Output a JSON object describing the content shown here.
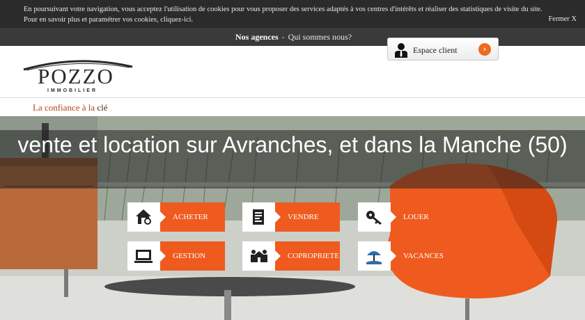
{
  "cookie_bar": {
    "line1": "En poursuivant votre navigation, vous acceptez l'utilisation de cookies pour vous proposer des services adaptés à vos centres d'intérêts et réaliser des statistiques de visite du site.",
    "line2": "Pour en savoir plus et paramétrer vos cookies, cliquez-ici.",
    "close": "Fermer X"
  },
  "nav": {
    "agences": "Nos agences",
    "separator": "-",
    "about": "Qui sommes nous?"
  },
  "client_button": {
    "label": "Espace client",
    "icon": "person-icon",
    "arrow": "›"
  },
  "logo": {
    "word": "POZZO",
    "sub": "IMMOBILIER"
  },
  "tagline": {
    "text": "La confiance à la ",
    "highlight": "clé"
  },
  "hero": {
    "title": "vente et location sur Avranches, et dans la Manche (50)"
  },
  "services": [
    {
      "label": "ACHETER",
      "icon": "house-icon"
    },
    {
      "label": "VENDRE",
      "icon": "document-icon"
    },
    {
      "label": "LOUER",
      "icon": "keys-icon"
    },
    {
      "label": "GESTION",
      "icon": "computer-icon"
    },
    {
      "label": "COPROPRIETE",
      "icon": "people-icon"
    },
    {
      "label": "VACANCES",
      "icon": "beach-icon"
    }
  ],
  "colors": {
    "accent": "#ef5b1e",
    "cookie_bar": "#2b2b2b",
    "nav_band": "#3a3a3a",
    "tagline": "#b34316"
  }
}
